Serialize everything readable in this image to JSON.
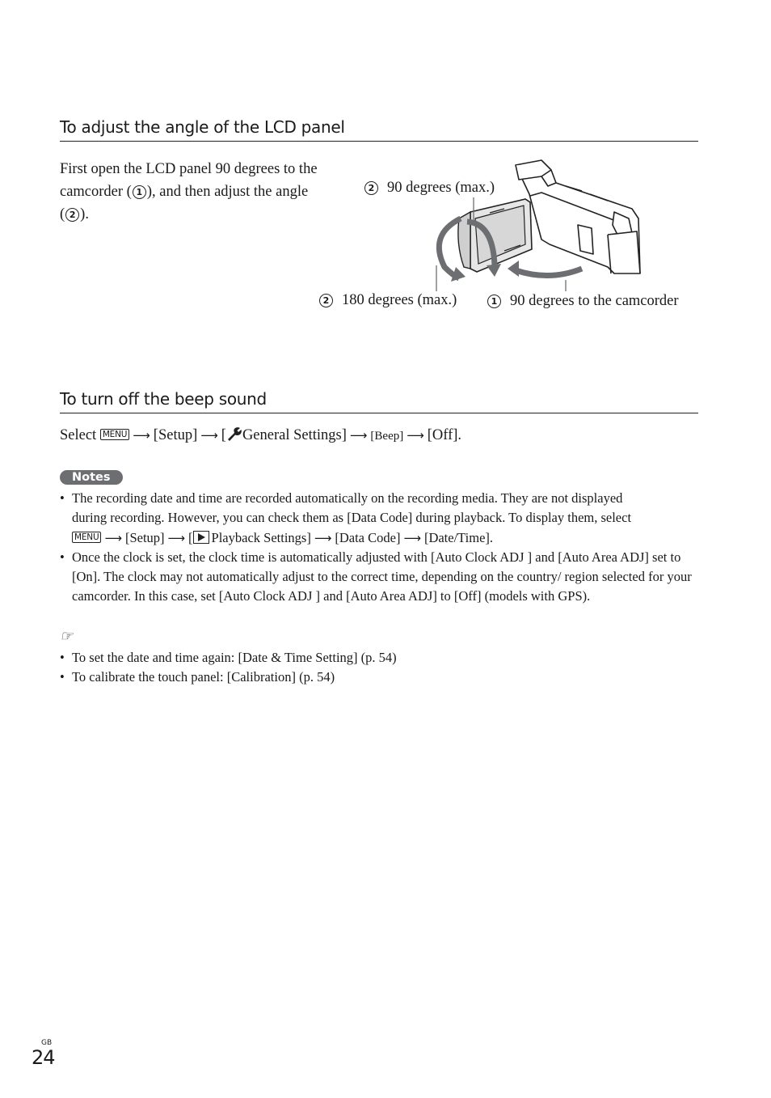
{
  "section1": {
    "heading": "To adjust the angle of the LCD panel",
    "intro_part1": "First open the LCD panel 90 degrees to the camcorder (",
    "intro_part2": "), and then adjust the angle (",
    "intro_part3": ").",
    "intro_line1": "First open the LCD panel 90 degrees to the",
    "intro_line2_a": "camcorder (",
    "intro_line2_b": "), and then adjust the angle",
    "intro_line3_a": "(",
    "intro_line3_b": ").",
    "marker1": "1",
    "marker2": "2",
    "diagram": {
      "icon": "camcorder-lcd-rotation-illustration",
      "label_90max_marker": "2",
      "label_90max": "90 degrees (max.)",
      "label_180max_marker": "2",
      "label_180max": "180 degrees (max.)",
      "label_90cam_marker": "1",
      "label_90cam": "90 degrees to the camcorder"
    }
  },
  "section2": {
    "heading": "To turn off the beep sound",
    "select": "Select",
    "menu_key": "MENU",
    "step_setup": "[Setup]",
    "step_general_open": "[",
    "step_general_icon": "wrench-icon",
    "step_general": "General Settings]",
    "step_beep": "[Beep]",
    "step_off": "[Off]."
  },
  "notes": {
    "badge": "Notes",
    "items": [
      {
        "text_line1": "The recording date and time are recorded automatically on the recording media. They are not displayed",
        "text_line2": "during recording. However, you can check them as [Data Code] during playback. To display them, select",
        "menu_key": "MENU",
        "step_setup": "[Setup]",
        "step_playback_open": "[",
        "step_playback_icon": "play-icon",
        "step_playback": "Playback Settings]",
        "step_datacode": "[Data Code]",
        "step_datetime": "[Date/Time]."
      },
      {
        "text": "Once the clock is set, the clock time is automatically adjusted with [Auto Clock ADJ ] and [Auto Area ADJ] set to [On]. The clock may not automatically adjust to the correct time, depending on the country/ region selected for your camcorder. In this case, set [Auto Clock ADJ ] and [Auto Area ADJ] to [Off] (models with GPS)."
      }
    ]
  },
  "tips": {
    "icon": "pointing-hand-icon",
    "items": [
      "To set the date and time again: [Date & Time Setting] (p. 54)",
      "To calibrate the touch panel: [Calibration] (p. 54)"
    ]
  },
  "footer": {
    "region": "GB",
    "page_number": "24"
  }
}
